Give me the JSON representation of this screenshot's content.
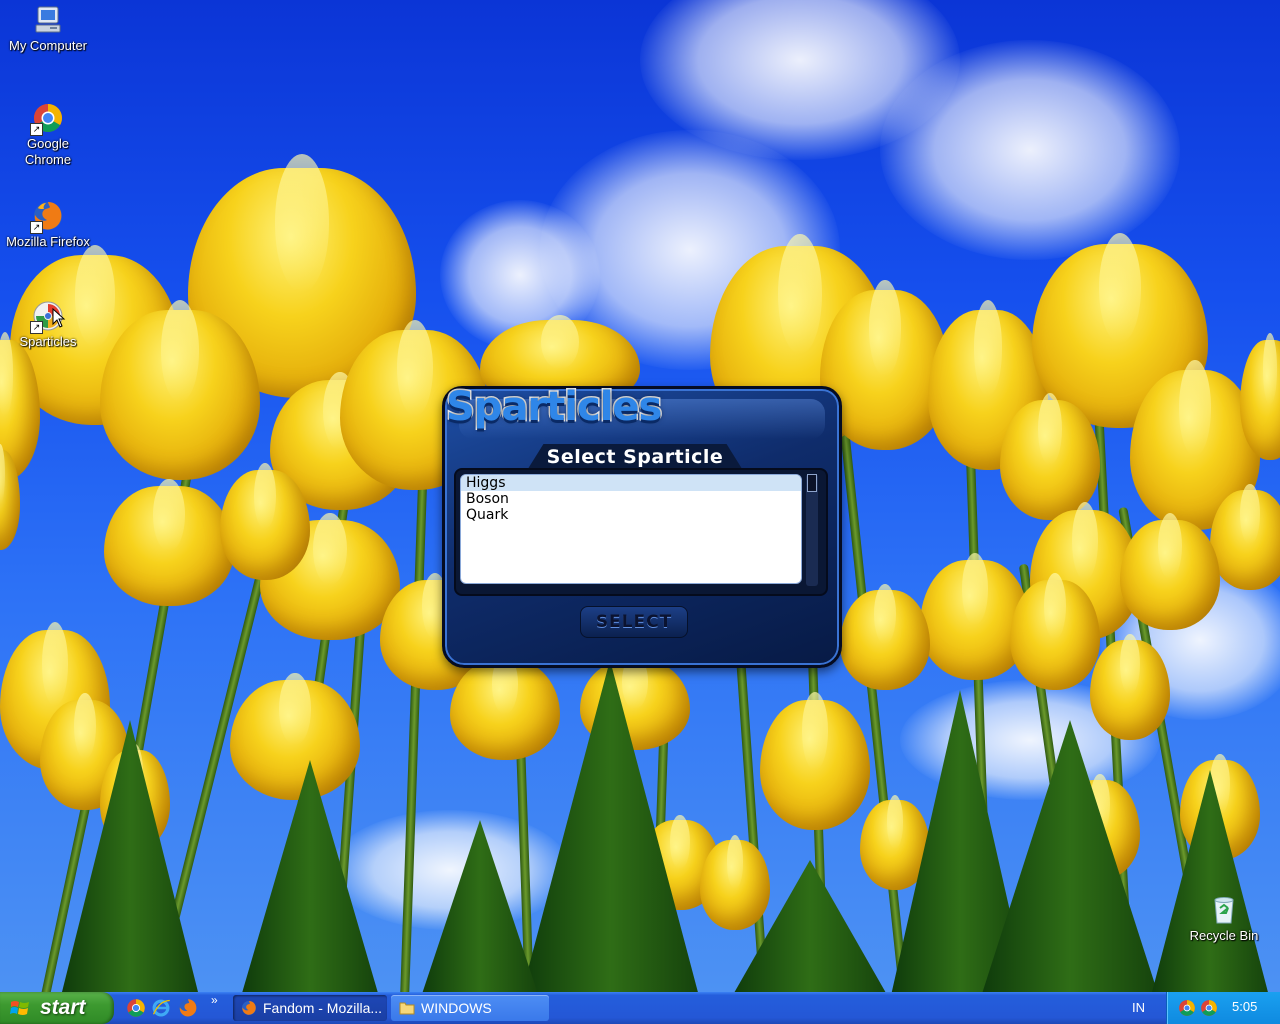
{
  "desktop": {
    "icons": [
      {
        "label": "My Computer"
      },
      {
        "label": "Google Chrome"
      },
      {
        "label": "Mozilla Firefox"
      },
      {
        "label": "Sparticles"
      },
      {
        "label": "Recycle Bin"
      }
    ]
  },
  "sparticles": {
    "logo_text": "Sparticles",
    "heading": "Select Sparticle",
    "items": [
      "Higgs",
      "Boson",
      "Quark"
    ],
    "selected_index": 0,
    "select_button_label": "SELECT"
  },
  "taskbar": {
    "start_label": "start",
    "quick_launch": [
      "chrome-icon",
      "ie-icon",
      "firefox-icon"
    ],
    "quick_launch_more": "»",
    "tasks": [
      {
        "label": "Fandom - Mozilla...",
        "icon": "firefox-icon",
        "active": true
      },
      {
        "label": "WINDOWS",
        "icon": "folder-icon",
        "active": false
      }
    ],
    "language": "IN",
    "clock": "5:05"
  },
  "colors": {
    "taskbar_blue": "#245edc",
    "start_green": "#3d9a30",
    "tray_blue": "#0f8ae0",
    "sparticles_frame": "#0f2c6b",
    "list_selection": "#cfe3f6"
  }
}
